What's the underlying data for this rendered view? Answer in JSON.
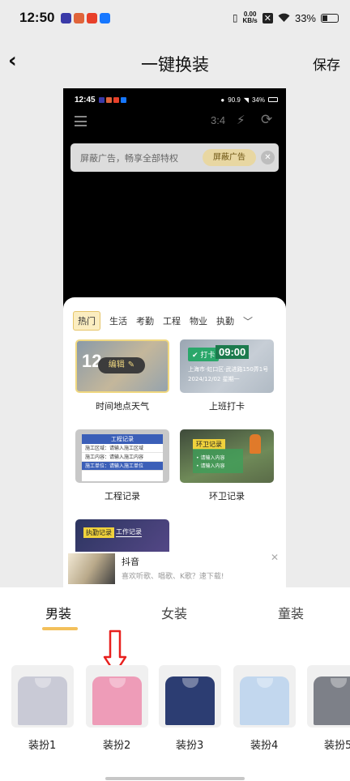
{
  "status_bar": {
    "time": "12:50",
    "net_speed_value": "0.00",
    "net_speed_unit": "KB/s",
    "battery": "33%",
    "app_colors": [
      "#3a3aa8",
      "#e0643a",
      "#e8402a",
      "#1677ff"
    ]
  },
  "header": {
    "back_icon": "back-chevron-icon",
    "title": "一键换装",
    "save_label": "保存"
  },
  "preview": {
    "status": {
      "time": "12:45",
      "battery": "34%",
      "speed": "90.9"
    },
    "toolbar": {
      "ratio": "3:4",
      "flash": "⚡",
      "rotate": "⟳"
    },
    "ad": {
      "text": "屏蔽广告，畅享全部特权",
      "button": "屏蔽广告",
      "close": "✕"
    },
    "tabs": [
      "热门",
      "生活",
      "考勤",
      "工程",
      "物业",
      "执勤"
    ],
    "more_chevron": "﹀",
    "templates": [
      {
        "name": "时间地点天气",
        "thumb": {
          "big": "12",
          "edit": "编辑",
          "pencil": "✎"
        }
      },
      {
        "name": "上班打卡",
        "thumb": {
          "tag": "✔ 打卡",
          "clock": "09:00",
          "line1": "上海市·虹口区·武进路150弄1号",
          "line2": "2024/12/02 星期一"
        }
      },
      {
        "name": "工程记录",
        "thumb": {
          "header": "工程记录",
          "rows": [
            "施工区域：请输入施工区域",
            "施工内容：请输入施工内容",
            "施工单位：请输入施工单位"
          ]
        }
      },
      {
        "name": "环卫记录",
        "thumb": {
          "tag": "环卫记录",
          "lines": [
            "• 请输入内容",
            "• 请输入内容"
          ]
        }
      },
      {
        "name": "",
        "thumb": {
          "tag1": "执勤记录",
          "tag2": "工作记录"
        }
      }
    ],
    "banner": {
      "title": "抖音",
      "subtitle": "喜欢听歌、唱歌、K歌？速下载!",
      "close": "✕"
    }
  },
  "categories": [
    "男装",
    "女装",
    "童装"
  ],
  "active_category": "男装",
  "accent_color": "#f3c05b",
  "arrow_color": "#e8201e",
  "outfits": [
    {
      "label": "装扮1",
      "color": "#c9cad6"
    },
    {
      "label": "装扮2",
      "color": "#ee9cb8"
    },
    {
      "label": "装扮3",
      "color": "#2c3d72"
    },
    {
      "label": "装扮4",
      "color": "#c2d7ee"
    },
    {
      "label": "装扮5",
      "color": "#7d8088"
    }
  ]
}
